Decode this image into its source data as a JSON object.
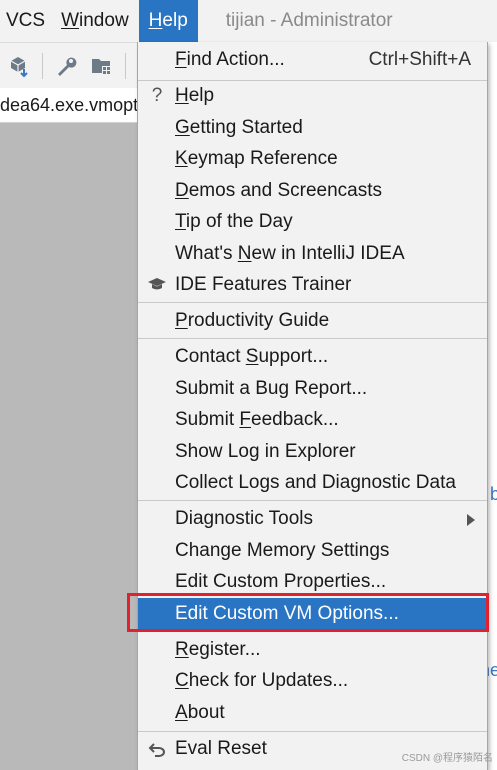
{
  "menubar": {
    "items": [
      {
        "label": "VCS",
        "mnemonic": ""
      },
      {
        "label": "Window",
        "mnemonic": "W",
        "rest": "indow"
      },
      {
        "label": "Help",
        "mnemonic": "H",
        "rest": "elp",
        "active": true
      }
    ],
    "title": "tijian - Administrator"
  },
  "toolbar": {
    "icons": [
      "build-icon",
      "wrench-icon",
      "project-structure-icon"
    ]
  },
  "tab": {
    "label": "dea64.exe.vmopt"
  },
  "editor": {
    "fragment_1": "b",
    "fragment_2": "ne"
  },
  "help_menu": {
    "find_action": {
      "u": "F",
      "rest": "ind Action...",
      "shortcut": "Ctrl+Shift+A"
    },
    "help": {
      "u": "H",
      "rest": "elp",
      "icon": "question-icon"
    },
    "getting_started": {
      "u": "G",
      "rest": "etting Started"
    },
    "keymap_reference": {
      "u": "K",
      "rest": "eymap Reference"
    },
    "demos": {
      "u": "D",
      "rest": "emos and Screencasts"
    },
    "tip": {
      "u": "T",
      "rest": "ip of the Day"
    },
    "whats_new": {
      "pre": "What's ",
      "u": "N",
      "rest": "ew in IntelliJ IDEA"
    },
    "features_trainer": {
      "label": "IDE Features Trainer",
      "icon": "graduation-cap-icon"
    },
    "productivity": {
      "u": "P",
      "rest": "roductivity Guide"
    },
    "contact_support": {
      "pre": "Contact ",
      "u": "S",
      "rest": "upport..."
    },
    "submit_bug": {
      "label": "Submit a Bug Report..."
    },
    "submit_feedback": {
      "pre": "Submit ",
      "u": "F",
      "rest": "eedback..."
    },
    "show_log": {
      "label": "Show Log in Explorer"
    },
    "collect_logs": {
      "label": "Collect Logs and Diagnostic Data"
    },
    "diagnostic_tools": {
      "label": "Diagnostic Tools"
    },
    "change_memory": {
      "label": "Change Memory Settings"
    },
    "edit_props": {
      "label": "Edit Custom Properties..."
    },
    "edit_vm": {
      "label": "Edit Custom VM Options...",
      "selected": true
    },
    "register": {
      "u": "R",
      "rest": "egister..."
    },
    "check_updates": {
      "u": "C",
      "rest": "heck for Updates..."
    },
    "about": {
      "u": "A",
      "rest": "bout"
    },
    "eval_reset": {
      "label": "Eval Reset",
      "icon": "undo-icon"
    }
  },
  "colors": {
    "accent": "#2a74c4",
    "highlight_border": "#e0212e",
    "menu_bg": "#f2f2f2"
  },
  "watermark": "CSDN @程序猿陌名"
}
